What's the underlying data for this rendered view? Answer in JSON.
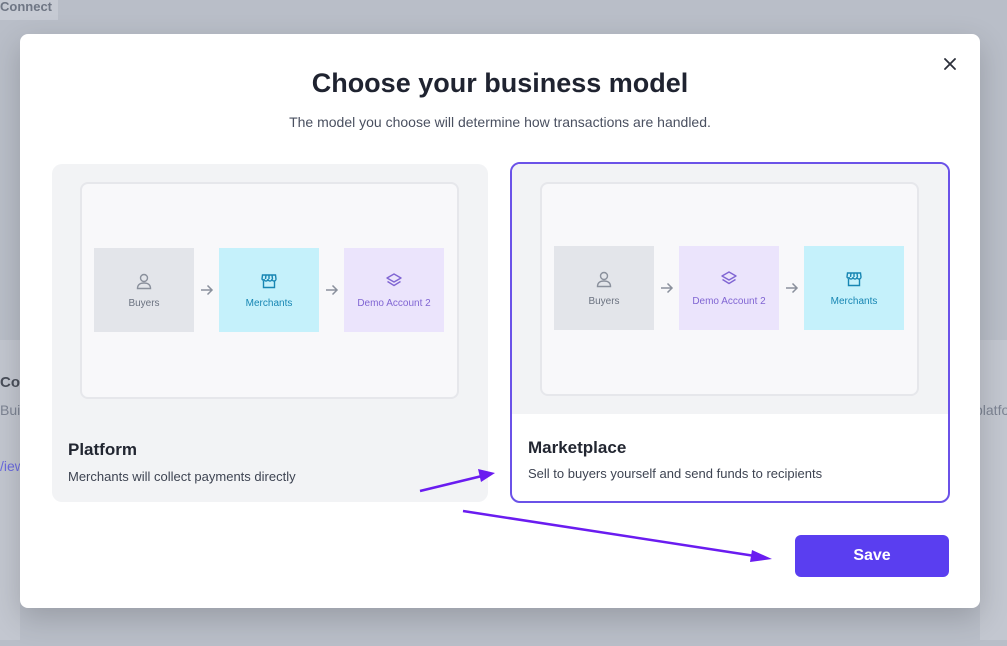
{
  "background": {
    "tab_label": "Connect",
    "left_title": "Co",
    "left_text": "Buil",
    "left_link": "/iew",
    "right_text": "platform"
  },
  "modal": {
    "title": "Choose your business model",
    "subtitle": "The model you choose will determine how transactions are handled.",
    "close_icon": "close-icon",
    "options": [
      {
        "title": "Platform",
        "description": "Merchants will collect payments directly",
        "selected": false,
        "flow": [
          {
            "label": "Buyers",
            "icon": "user-icon"
          },
          {
            "label": "Merchants",
            "icon": "storefront-icon"
          },
          {
            "label": "Demo Account 2",
            "icon": "layers-icon"
          }
        ]
      },
      {
        "title": "Marketplace",
        "description": "Sell to buyers yourself and send funds to recipients",
        "selected": true,
        "flow": [
          {
            "label": "Buyers",
            "icon": "user-icon"
          },
          {
            "label": "Demo Account 2",
            "icon": "layers-icon"
          },
          {
            "label": "Merchants",
            "icon": "storefront-icon"
          }
        ]
      }
    ],
    "save_label": "Save"
  },
  "colors": {
    "accent": "#5a3ef0",
    "selected_border": "#6b52e8",
    "annotation_arrow": "#6a1cf0",
    "buyers_bg": "#e3e5ea",
    "merchants_bg": "#c5f1fb",
    "demo_bg": "#ebe4fc"
  }
}
